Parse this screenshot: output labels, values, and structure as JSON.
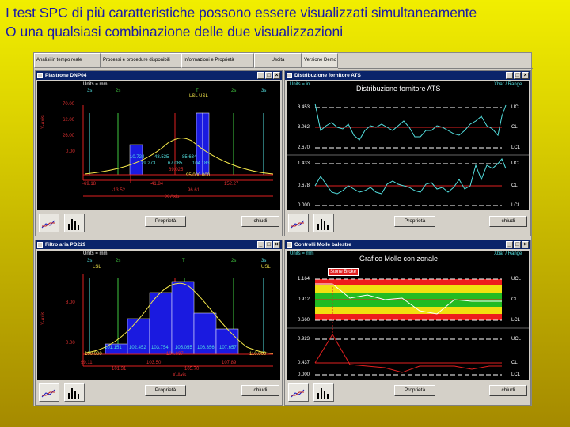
{
  "heading": {
    "line1": "I test SPC di più caratteristiche possono essere visualizzati simultaneamente",
    "line2": "O una qualsiasi combinazione delle due visualizzazioni"
  },
  "tabs": [
    "Analisi in tempo reale",
    "Processi e procedure disponibili",
    "Informazioni e Proprietà",
    "Uscita",
    "Versione Demo"
  ],
  "buttons": {
    "properties": "Proprietà",
    "close": "chiudi"
  },
  "icons": [
    "trend-chart-icon",
    "histogram-icon"
  ],
  "colors": {
    "titlebar": "#0a246a",
    "ucl": "#ffffff",
    "cl": "#e02020",
    "data": "#53e0e0",
    "bar": "#1a1ae0",
    "curve": "#f5e84a"
  },
  "win1": {
    "title": "Piastrone DNP04",
    "units": "Units = mm",
    "sigma_top": [
      "3s",
      "2s",
      "T",
      "2s",
      "3s"
    ],
    "spec": "LSL USL",
    "yaxis": "Y-Axis",
    "yticks": [
      "70.00",
      "62.00",
      "26.00",
      "0.00"
    ],
    "bin_labels": [
      "10.724",
      "48.535",
      "85.634",
      "29.273",
      "67.085",
      "104.183"
    ],
    "red_center": "69.025",
    "yellow_right": "95.000 000",
    "xticks_top": [
      "-69.18",
      "-41.84",
      "152.27"
    ],
    "xticks_bot": [
      "-13.52",
      "96.61"
    ],
    "xaxis": "X-Axis"
  },
  "win2": {
    "title": "Distribuzione fornitore ATS",
    "units": "Units = in",
    "chart_title": "Distribuzione fornitore ATS",
    "mode": "Xbar / Range",
    "xbar_limits": [
      "3.453",
      "3.062",
      "2.670"
    ],
    "range_limits": [
      "1.433",
      "0.678",
      "0.000"
    ],
    "ucl": "UCL",
    "cl": "CL",
    "lcl": "LCL"
  },
  "win3": {
    "title": "Filtro aria PD229",
    "units": "Units = mm",
    "sigma_top": [
      "3s",
      "2s",
      "T",
      "2s",
      "3s"
    ],
    "lsl": "LSL",
    "usl": "USL",
    "yaxis": "Y-Axis",
    "yticks": [
      "8.00",
      "0.00"
    ],
    "left_spec": "100.000",
    "right_spec": "110.000",
    "red_center": "104.697",
    "bin_labels": [
      "101.151",
      "102.452",
      "103.754",
      "105.055",
      "106.356",
      "107.657"
    ],
    "xticks_top": [
      "99.11",
      "103.50",
      "107.89"
    ],
    "xticks_bot": [
      "101.31",
      "105.70"
    ],
    "xaxis": "X-Axis"
  },
  "win4": {
    "title": "Controlli Molle balestre",
    "units": "Units = mm",
    "chart_title": "Grafico Molle con zonale",
    "mode": "Xbar / Range",
    "tag": "Stone Broke",
    "xbar_limits": [
      "1.164",
      "0.912",
      "0.660"
    ],
    "range_limits": [
      "0.923",
      "0.437",
      "0.000"
    ],
    "ucl": "UCL",
    "cl": "CL",
    "lcl": "LCL"
  }
}
